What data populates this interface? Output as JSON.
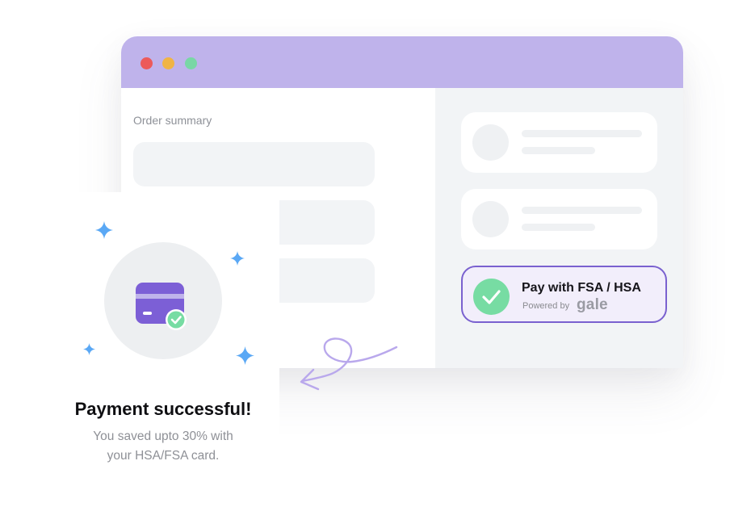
{
  "order_summary": {
    "title": "Order summary"
  },
  "payment_option": {
    "title": "Pay with FSA / HSA",
    "powered_by": "Powered by",
    "brand": "gale"
  },
  "success": {
    "title": "Payment successful!",
    "subtitle_line1": "You saved upto 30% with",
    "subtitle_line2": "your HSA/FSA card."
  },
  "colors": {
    "accent_purple": "#7a61cf",
    "titlebar": "#bfb3eb",
    "success_green": "#77dca3",
    "sparkle_blue": "#5aa8f5"
  },
  "icons": {
    "window_controls": [
      "close-dot",
      "minimize-dot",
      "maximize-dot"
    ],
    "payment_check": "check-circle-icon",
    "card": "credit-card-icon",
    "sparkles": "sparkle-icon",
    "arrow": "curly-arrow-icon"
  }
}
